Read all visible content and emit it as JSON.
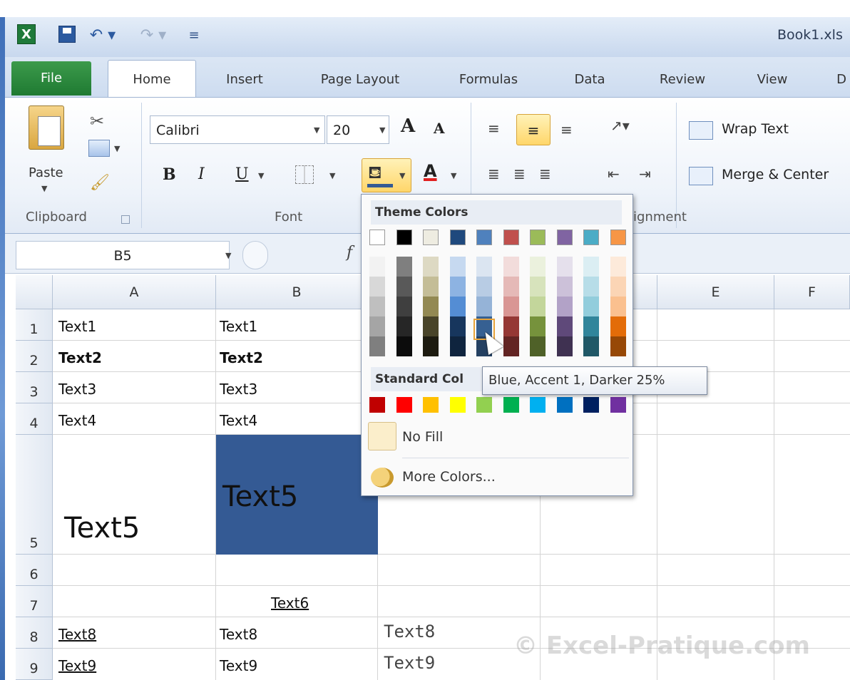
{
  "window": {
    "title": "Book1.xls"
  },
  "tabs": [
    {
      "label": "File"
    },
    {
      "label": "Home"
    },
    {
      "label": "Insert"
    },
    {
      "label": "Page Layout"
    },
    {
      "label": "Formulas"
    },
    {
      "label": "Data"
    },
    {
      "label": "Review"
    },
    {
      "label": "View"
    },
    {
      "label": "D"
    }
  ],
  "ribbon": {
    "paste_label": "Paste",
    "font_name": "Calibri",
    "font_size": "20",
    "bold": "B",
    "italic": "I",
    "underline": "U",
    "font_color_glyph": "A",
    "grow_font": "A",
    "shrink_font": "A",
    "wrap_text": "Wrap Text",
    "merge_center": "Merge & Center",
    "groups": {
      "clipboard": "Clipboard",
      "font": "Font",
      "alignment": "ignment"
    }
  },
  "formula_bar": {
    "name_box": "B5",
    "fx": "f"
  },
  "grid": {
    "columns": [
      "A",
      "B",
      "E",
      "F"
    ],
    "rows": [
      "1",
      "2",
      "3",
      "4",
      "5",
      "6",
      "7",
      "8",
      "9"
    ],
    "cells": {
      "A1": "Text1",
      "B1": "Text1",
      "A2": "Text2",
      "B2": "Text2",
      "A3": "Text3",
      "B3": "Text3",
      "A4": "Text4",
      "B4": "Text4",
      "A5": "Text5",
      "B5": "Text5",
      "B7": "Text6",
      "A8": "Text8",
      "B8": "Text8",
      "C8": "Text8",
      "A9": "Text9",
      "B9": "Text9",
      "C9": "Text9"
    },
    "b5_fill_color": "#345a94"
  },
  "fill_dropdown": {
    "theme_header": "Theme Colors",
    "standard_header": "Standard Col",
    "theme_top_row": [
      "#ffffff",
      "#000000",
      "#eeece1",
      "#1f497d",
      "#4f81bd",
      "#c0504d",
      "#9bbb59",
      "#8064a2",
      "#4bacc6",
      "#f79646"
    ],
    "theme_shades": [
      [
        "#f2f2f2",
        "#d8d8d8",
        "#bfbfbf",
        "#a5a5a5",
        "#7f7f7f"
      ],
      [
        "#7f7f7f",
        "#595959",
        "#3f3f3f",
        "#262626",
        "#0c0c0c"
      ],
      [
        "#ddd9c3",
        "#c4bd97",
        "#938953",
        "#494429",
        "#1d1b10"
      ],
      [
        "#c6d9f0",
        "#8db3e2",
        "#548dd4",
        "#17365d",
        "#0f243e"
      ],
      [
        "#dbe5f1",
        "#b8cce4",
        "#95b3d7",
        "#366092",
        "#244061"
      ],
      [
        "#f2dcdb",
        "#e5b9b7",
        "#d99694",
        "#953734",
        "#632423"
      ],
      [
        "#ebf1dd",
        "#d7e3bc",
        "#c3d69b",
        "#76923c",
        "#4f6128"
      ],
      [
        "#e5e0ec",
        "#ccc1d9",
        "#b2a2c7",
        "#5f497a",
        "#3f3151"
      ],
      [
        "#dbeef3",
        "#b7dde8",
        "#92cddc",
        "#31859b",
        "#205867"
      ],
      [
        "#fdeada",
        "#fbd5b5",
        "#fac08f",
        "#e36c09",
        "#974806"
      ]
    ],
    "standard_colors": [
      "#c00000",
      "#ff0000",
      "#ffc000",
      "#ffff00",
      "#92d050",
      "#00b050",
      "#00b0f0",
      "#0070c0",
      "#002060",
      "#7030a0"
    ],
    "no_fill": "No Fill",
    "more_colors": "More Colors...",
    "tooltip": "Blue, Accent 1, Darker 25%"
  },
  "watermark": "© Excel-Pratique.com"
}
